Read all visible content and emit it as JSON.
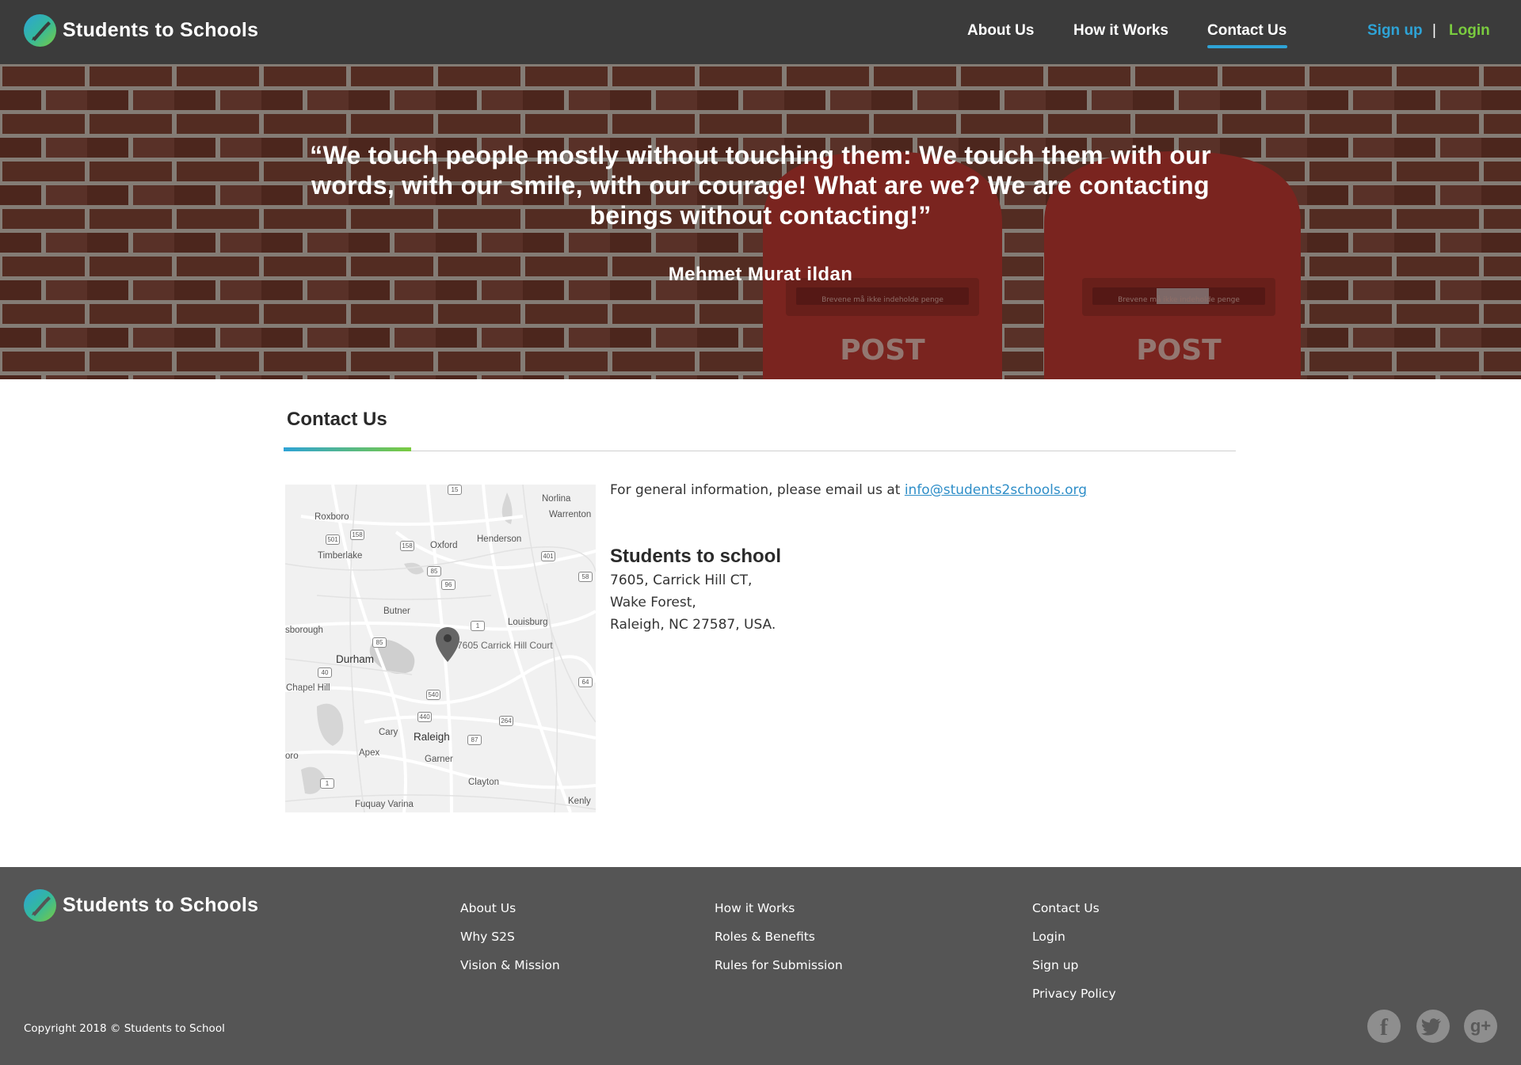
{
  "header": {
    "brand": "Students to Schools",
    "nav": [
      {
        "label": "About Us"
      },
      {
        "label": "How it Works"
      },
      {
        "label": "Contact Us",
        "active": true
      }
    ],
    "signup": "Sign up",
    "separator": "|",
    "login": "Login"
  },
  "hero": {
    "quote": "“We touch people mostly without touching them: We touch them with our words, with our smile, with our courage! What are we? We are contacting beings without contacting!”",
    "author": "Mehmet Murat ildan",
    "mailbox_text": "POST",
    "mailbox_slot_text": "Brevene må ikke indeholde penge"
  },
  "contact": {
    "title": "Contact Us",
    "general_prefix": "For general information, please email us at ",
    "email": "info@students2schools.org",
    "org_name": "Students to school",
    "address_line1": "7605, Carrick Hill CT,",
    "address_line2": "Wake Forest,",
    "address_line3": "Raleigh, NC 27587, USA."
  },
  "map": {
    "pin_label": "7605 Carrick Hill Court",
    "places": [
      "Roxboro",
      "Norlina",
      "Warrenton",
      "Henderson",
      "Oxford",
      "Timberlake",
      "Butner",
      "Louisburg",
      "sborough",
      "Durham",
      "Chapel Hill",
      "Cary",
      "Raleigh",
      "Apex",
      "Garner",
      "Clayton",
      "Kenly",
      "Fuquay Varina",
      "oro"
    ],
    "shields": [
      "15",
      "501",
      "158",
      "158",
      "401",
      "85",
      "96",
      "58",
      "1",
      "85",
      "40",
      "540",
      "64",
      "440",
      "264",
      "87",
      "1"
    ]
  },
  "footer": {
    "brand": "Students to Schools",
    "col1": [
      "About Us",
      "Why S2S",
      "Vision & Mission"
    ],
    "col2": [
      "How it Works",
      "Roles & Benefits",
      "Rules for Submission"
    ],
    "col3": [
      "Contact Us",
      "Login",
      "Sign up",
      "Privacy Policy"
    ],
    "copyright": "Copyright 2018 ©  Students to School",
    "social": {
      "facebook": "f",
      "twitter": "twitter-icon",
      "google_plus": "g+"
    }
  },
  "colors": {
    "header_bg": "#3b3b3b",
    "footer_bg": "#555555",
    "accent_blue": "#2ea3d6",
    "accent_green": "#7acb3f"
  }
}
